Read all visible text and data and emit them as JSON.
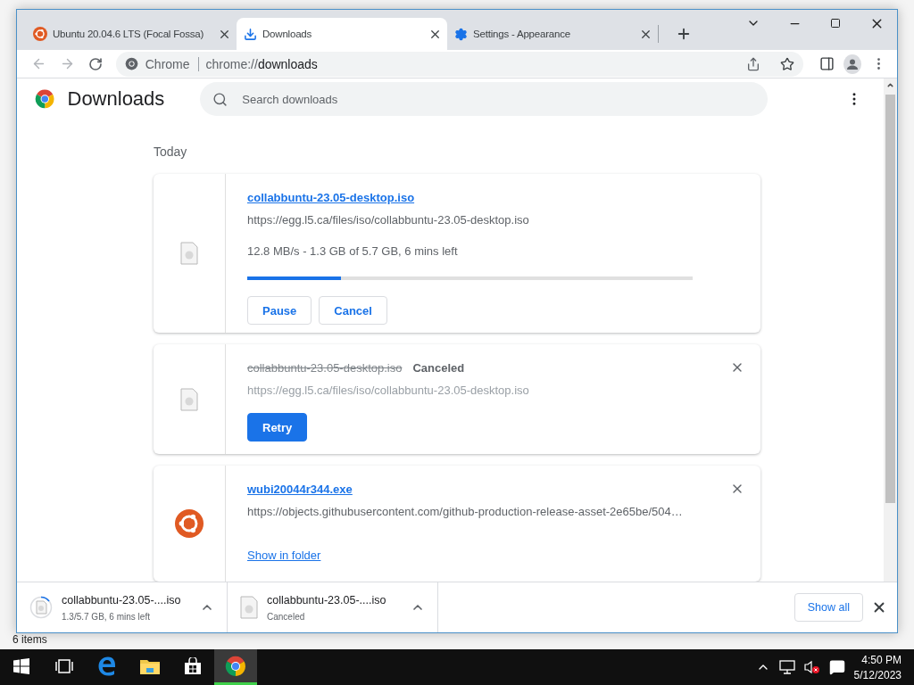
{
  "tabs": [
    {
      "title": "Ubuntu 20.04.6 LTS (Focal Fossa)",
      "kind": "ubuntu",
      "selected": false
    },
    {
      "title": "Downloads",
      "kind": "download",
      "selected": true
    },
    {
      "title": "Settings - Appearance",
      "kind": "settings",
      "selected": false
    }
  ],
  "toolbar": {
    "origin": "Chrome",
    "url_prefix": "chrome://",
    "url_path": "downloads"
  },
  "page": {
    "title": "Downloads",
    "search": {
      "placeholder": "Search downloads"
    },
    "date_heading": "Today"
  },
  "downloads": [
    {
      "kind": "in_progress",
      "file_name": "collabbuntu-23.05-desktop.iso",
      "url": "https://egg.l5.ca/files/iso/collabbuntu-23.05-desktop.iso",
      "status": "12.8 MB/s - 1.3 GB of 5.7 GB, 6 mins left",
      "level": 0.21,
      "buttons": [
        "Pause",
        "Cancel"
      ]
    },
    {
      "kind": "canceled",
      "file_name": "collabbuntu-23.05-desktop.iso",
      "state_label": "Canceled",
      "url": "https://egg.l5.ca/files/iso/collabbuntu-23.05-desktop.iso",
      "buttons": [
        "Retry"
      ]
    },
    {
      "kind": "complete",
      "file_name": "wubi20044r344.exe",
      "url": "https://objects.githubusercontent.com/github-production-release-asset-2e65be/504…",
      "link": "Show in folder"
    }
  ],
  "shelf": {
    "items": [
      {
        "kind": "in_progress",
        "name": "collabbuntu-23.05-....iso",
        "status": "1.3/5.7 GB, 6 mins left"
      },
      {
        "kind": "canceled",
        "name": "collabbuntu-23.05-....iso",
        "status": "Canceled"
      }
    ],
    "show_all": "Show all"
  },
  "desktop": {
    "status": "6 items"
  },
  "taskbar": {
    "time": "4:50 PM",
    "date": "5/12/2023"
  }
}
